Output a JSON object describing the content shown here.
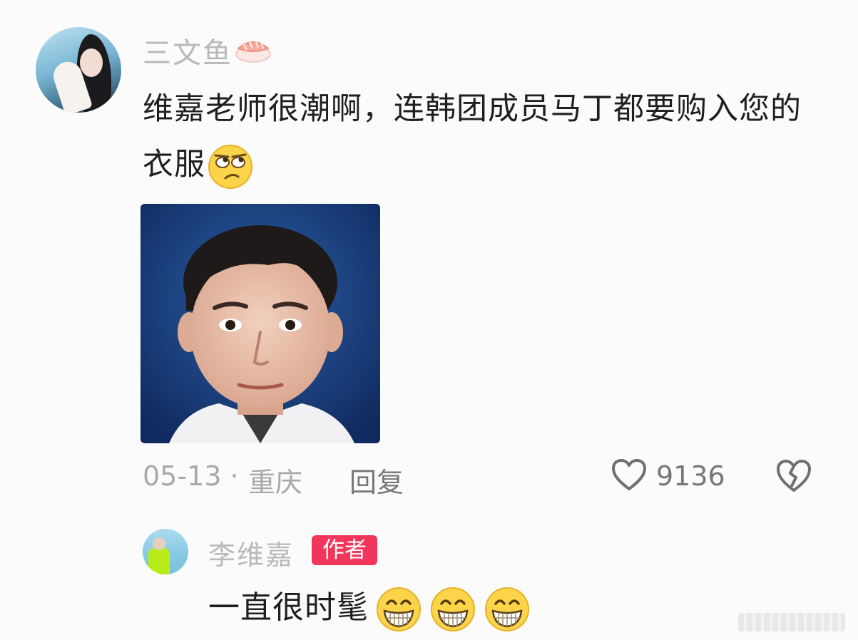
{
  "comment": {
    "username": "三文鱼",
    "username_emoji_icon": "sushi-icon",
    "text": "维嘉老师很潮啊，连韩团成员马丁都要购入您的衣服",
    "text_emoji_icon": "eye-roll-emoji",
    "attached_image_icon": "portrait-photo",
    "date": "05-13",
    "separator": "·",
    "location": "重庆",
    "reply_label": "回复",
    "like_icon": "heart-outline-icon",
    "like_count": "9136",
    "dislike_icon": "broken-heart-icon"
  },
  "reply": {
    "username": "李维嘉",
    "badge": "作者",
    "text": "一直很时髦",
    "emoji_icons": [
      "grinning-emoji",
      "grinning-emoji",
      "grinning-emoji"
    ]
  },
  "colors": {
    "badge_bg": "#f2355b",
    "username": "#b9b9b9",
    "text": "#1f1f1f",
    "meta": "#a9a9a9"
  }
}
